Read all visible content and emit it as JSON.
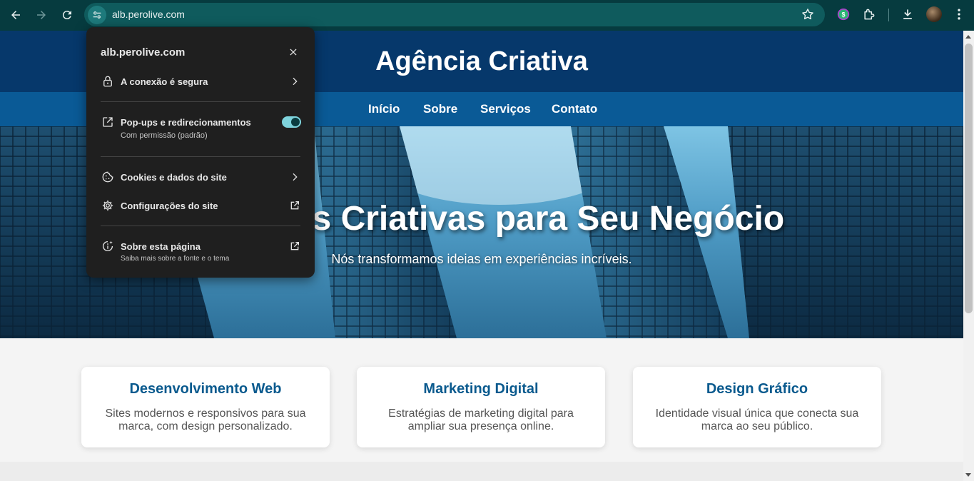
{
  "browser": {
    "url": "alb.perolive.com",
    "colors": {
      "toolbar": "#063b3f",
      "omnibox": "#0f5b5d"
    }
  },
  "site": {
    "title": "Agência Criativa",
    "nav": [
      "Início",
      "Sobre",
      "Serviços",
      "Contato"
    ],
    "hero": {
      "title": "Soluções Criativas para Seu Negócio",
      "subtitle": "Nós transformamos ideias em experiências incríveis."
    },
    "services": [
      {
        "title": "Desenvolvimento Web",
        "text": "Sites modernos e responsivos para sua marca, com design personalizado."
      },
      {
        "title": "Marketing Digital",
        "text": "Estratégias de marketing digital para ampliar sua presença online."
      },
      {
        "title": "Design Gráfico",
        "text": "Identidade visual única que conecta sua marca ao seu público."
      }
    ],
    "colors": {
      "header": "#06386b",
      "nav": "#0a5a96",
      "card_title": "#0a5a8e"
    }
  },
  "site_info_popup": {
    "domain": "alb.perolive.com",
    "connection": "A conexão é segura",
    "popups": {
      "label": "Pop-ups e redirecionamentos",
      "status": "Com permissão (padrão)",
      "enabled": true
    },
    "cookies": "Cookies e dados do site",
    "settings": "Configurações do site",
    "about": {
      "label": "Sobre esta página",
      "sub": "Saiba mais sobre a fonte e o tema"
    },
    "icons": [
      "lock-icon",
      "popup-icon",
      "cookie-icon",
      "gear-icon",
      "about-page-icon"
    ]
  }
}
